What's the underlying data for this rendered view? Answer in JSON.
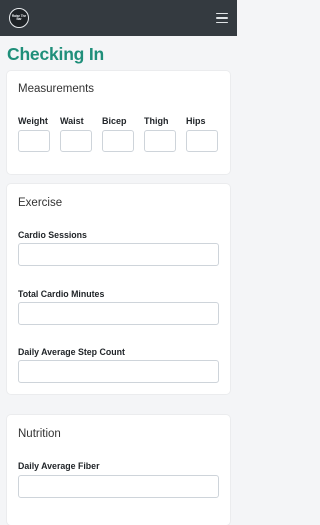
{
  "header": {
    "logo_text": "Raise The Bar",
    "menu_icon": "hamburger-menu-icon"
  },
  "page": {
    "title": "Checking In"
  },
  "measurements": {
    "title": "Measurements",
    "fields": [
      {
        "label": "Weight",
        "value": ""
      },
      {
        "label": "Waist",
        "value": ""
      },
      {
        "label": "Bicep",
        "value": ""
      },
      {
        "label": "Thigh",
        "value": ""
      },
      {
        "label": "Hips",
        "value": ""
      }
    ]
  },
  "exercise": {
    "title": "Exercise",
    "fields": [
      {
        "label": "Cardio Sessions",
        "value": ""
      },
      {
        "label": "Total Cardio Minutes",
        "value": ""
      },
      {
        "label": "Daily Average Step Count",
        "value": ""
      }
    ]
  },
  "nutrition": {
    "title": "Nutrition",
    "fields": [
      {
        "label": "Daily Average Fiber",
        "value": ""
      }
    ]
  },
  "colors": {
    "accent": "#1f8f7a",
    "navbar": "#343a40",
    "background": "#f4f5f7"
  }
}
